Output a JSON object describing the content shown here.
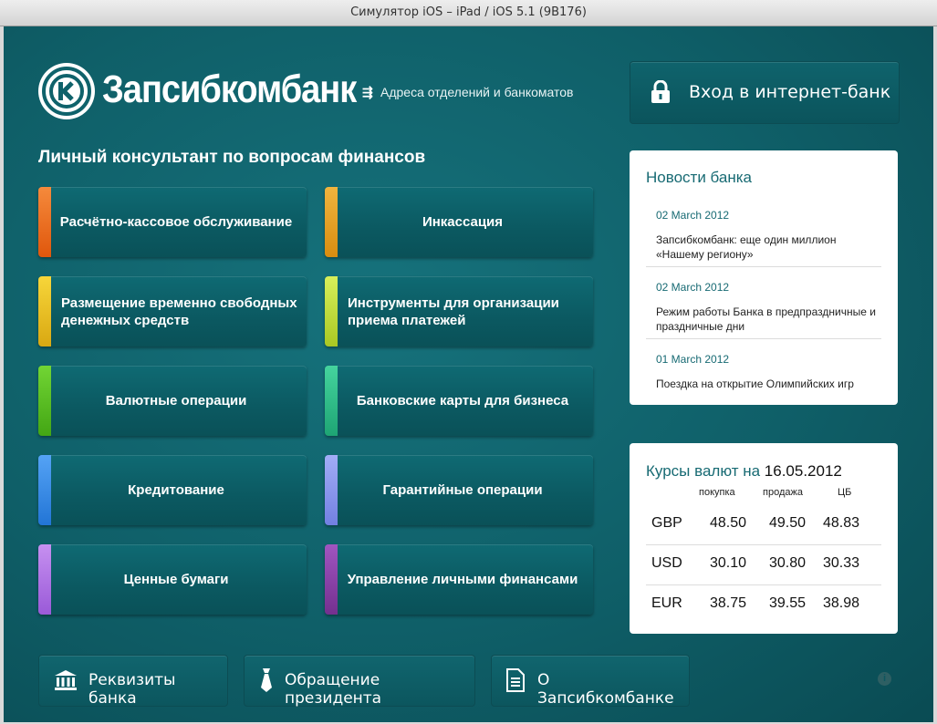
{
  "window": {
    "title": "Симулятор iOS – iPad / iOS 5.1 (9B176)"
  },
  "header": {
    "logo_text": "Запсибкомбанк",
    "branches_link": "Адреса отделений и банкоматов",
    "login_button": "Вход в интернет-банк"
  },
  "consultant": {
    "title": "Личный консультант по вопросам финансов",
    "services": [
      {
        "label": "Расчётно-кассовое обслуживание",
        "color": "#f26a1b"
      },
      {
        "label": "Инкассация",
        "color": "#e9a21d"
      },
      {
        "label": "Размещение временно свободных денежных средств",
        "color": "#f2c21b"
      },
      {
        "label": "Инструменты для организации приема платежей",
        "color": "#c8e23b"
      },
      {
        "label": "Валютные операции",
        "color": "#5cc21f"
      },
      {
        "label": "Банковские карты для бизнеса",
        "color": "#2fbf89"
      },
      {
        "label": "Кредитование",
        "color": "#3a8ff0"
      },
      {
        "label": "Гарантийные операции",
        "color": "#8a97f0"
      },
      {
        "label": "Ценные бумаги",
        "color": "#b071e6"
      },
      {
        "label": "Управление личными финансами",
        "color": "#8a3fa8"
      }
    ]
  },
  "news": {
    "title": "Новости банка",
    "items": [
      {
        "date": "02 March 2012",
        "text": "Запсибкомбанк: еще один миллион «Нашему региону»"
      },
      {
        "date": "02 March 2012",
        "text": "Режим  работы Банка в предпраздничные и праздничные дни"
      },
      {
        "date": "01 March 2012",
        "text": "Поездка на открытие Олимпийских игр"
      }
    ]
  },
  "rates": {
    "title": "Курсы валют на",
    "date": "16.05.2012",
    "columns": [
      "покупка",
      "продажа",
      "ЦБ"
    ],
    "rows": [
      {
        "currency": "GBP",
        "buy": "48.50",
        "sell": "49.50",
        "cb": "48.83"
      },
      {
        "currency": "USD",
        "buy": "30.10",
        "sell": "30.80",
        "cb": "30.33"
      },
      {
        "currency": "EUR",
        "buy": "38.75",
        "sell": "39.55",
        "cb": "38.98"
      }
    ]
  },
  "footer": {
    "buttons": [
      {
        "label": "Реквизиты банка",
        "icon": "bank-building-icon"
      },
      {
        "label": "Обращение президента",
        "icon": "tie-icon"
      },
      {
        "label": "О Запсибкомбанке",
        "icon": "document-icon"
      }
    ],
    "info_icon": "info-icon"
  }
}
